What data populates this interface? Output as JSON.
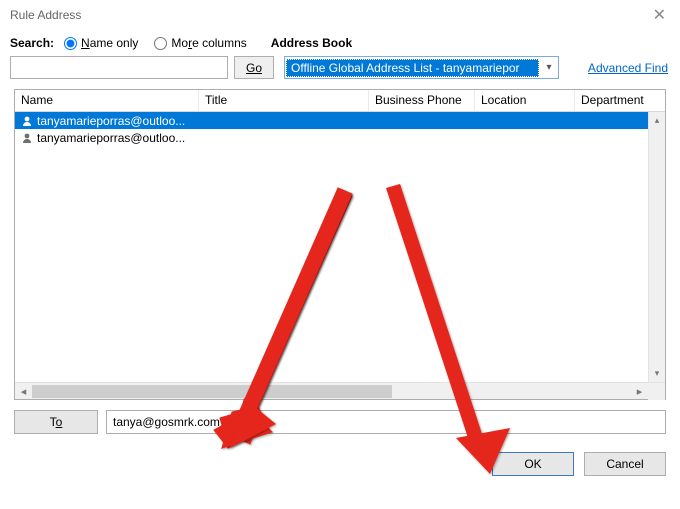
{
  "window": {
    "title": "Rule Address"
  },
  "search": {
    "label": "Search:",
    "name_only": "Name only",
    "more_columns": "More columns",
    "go_label": "Go",
    "value": ""
  },
  "address_book": {
    "label": "Address Book",
    "selected": "Offline Global Address List - tanyamariepor",
    "advanced_find": "Advanced Find"
  },
  "columns": {
    "name": "Name",
    "title": "Title",
    "business_phone": "Business Phone",
    "location": "Location",
    "department": "Department"
  },
  "rows": [
    {
      "display": "tanyamarieporras@outloo...",
      "selected": true
    },
    {
      "display": "tanyamarieporras@outloo...",
      "selected": false
    }
  ],
  "to": {
    "button": "To",
    "value": "tanya@gosmrk.com"
  },
  "footer": {
    "ok": "OK",
    "cancel": "Cancel"
  }
}
